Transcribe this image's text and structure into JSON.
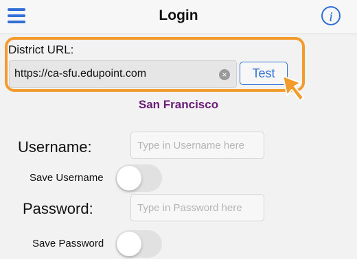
{
  "header": {
    "title": "Login",
    "menu_icon": "hamburger-menu-icon",
    "info_icon": "info-icon",
    "info_glyph": "i"
  },
  "district": {
    "url_label": "District URL:",
    "url_value": "https://ca-sfu.edupoint.com",
    "clear_glyph": "×",
    "test_button": "Test",
    "name": "San Francisco"
  },
  "login": {
    "username_label": "Username:",
    "username_placeholder": "Type in Username here",
    "save_username_label": "Save Username",
    "save_username_on": false,
    "password_label": "Password:",
    "password_placeholder": "Type in Password here",
    "save_password_label": "Save Password",
    "save_password_on": false
  },
  "colors": {
    "accent": "#2f6fd6",
    "highlight": "#f39b2d",
    "district_name": "#6a1b78"
  }
}
